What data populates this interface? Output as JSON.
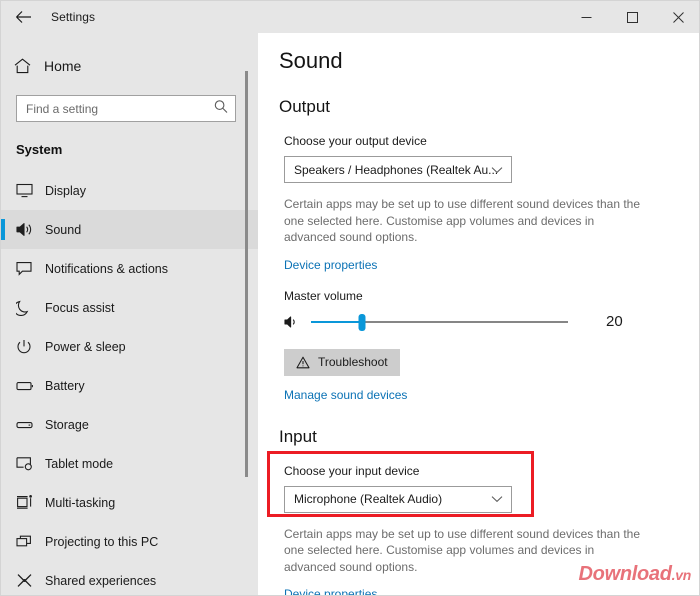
{
  "window": {
    "title": "Settings",
    "back_icon": "back-arrow-icon",
    "minimize_label": "Minimize",
    "maximize_label": "Maximize",
    "close_label": "Close"
  },
  "sidebar": {
    "home": {
      "label": "Home",
      "icon": "home-icon"
    },
    "search": {
      "placeholder": "Find a setting",
      "value": "",
      "icon": "search-icon"
    },
    "section_title": "System",
    "items": [
      {
        "label": "Display",
        "icon": "monitor-icon",
        "selected": false
      },
      {
        "label": "Sound",
        "icon": "speaker-icon",
        "selected": true
      },
      {
        "label": "Notifications & actions",
        "icon": "notification-icon",
        "selected": false
      },
      {
        "label": "Focus assist",
        "icon": "moon-icon",
        "selected": false
      },
      {
        "label": "Power & sleep",
        "icon": "power-icon",
        "selected": false
      },
      {
        "label": "Battery",
        "icon": "battery-icon",
        "selected": false
      },
      {
        "label": "Storage",
        "icon": "storage-icon",
        "selected": false
      },
      {
        "label": "Tablet mode",
        "icon": "tablet-icon",
        "selected": false
      },
      {
        "label": "Multi-tasking",
        "icon": "multitasking-icon",
        "selected": false
      },
      {
        "label": "Projecting to this PC",
        "icon": "project-icon",
        "selected": false
      },
      {
        "label": "Shared experiences",
        "icon": "share-icon",
        "selected": false
      }
    ]
  },
  "main": {
    "page_title": "Sound",
    "output": {
      "heading": "Output",
      "device_label": "Choose your output device",
      "device_value": "Speakers / Headphones (Realtek Au...",
      "chevron_icon": "chevron-down-icon",
      "description": "Certain apps may be set up to use different sound devices than the one selected here. Customise app volumes and devices in advanced sound options.",
      "device_properties_link": "Device properties",
      "volume_label": "Master volume",
      "volume_icon": "speaker-volume-icon",
      "volume_value": "20",
      "volume_percent": 20,
      "troubleshoot_label": "Troubleshoot",
      "troubleshoot_icon": "warning-triangle-icon",
      "manage_devices_link": "Manage sound devices"
    },
    "input": {
      "heading": "Input",
      "device_label": "Choose your input device",
      "device_value": "Microphone (Realtek Audio)",
      "chevron_icon": "chevron-down-icon",
      "description": "Certain apps may be set up to use different sound devices than the one selected here. Customise app volumes and devices in advanced sound options.",
      "device_properties_link": "Device properties"
    }
  },
  "annotation": {
    "shape": "rectangle",
    "color": "#ec1c24"
  },
  "watermark": {
    "text": "Download",
    "suffix": ".vn",
    "color": "#e8727a"
  },
  "colors": {
    "accent": "#0a97d9",
    "link": "#0b72b5",
    "chrome": "#e6e6e6",
    "annotation": "#ec1c24"
  }
}
